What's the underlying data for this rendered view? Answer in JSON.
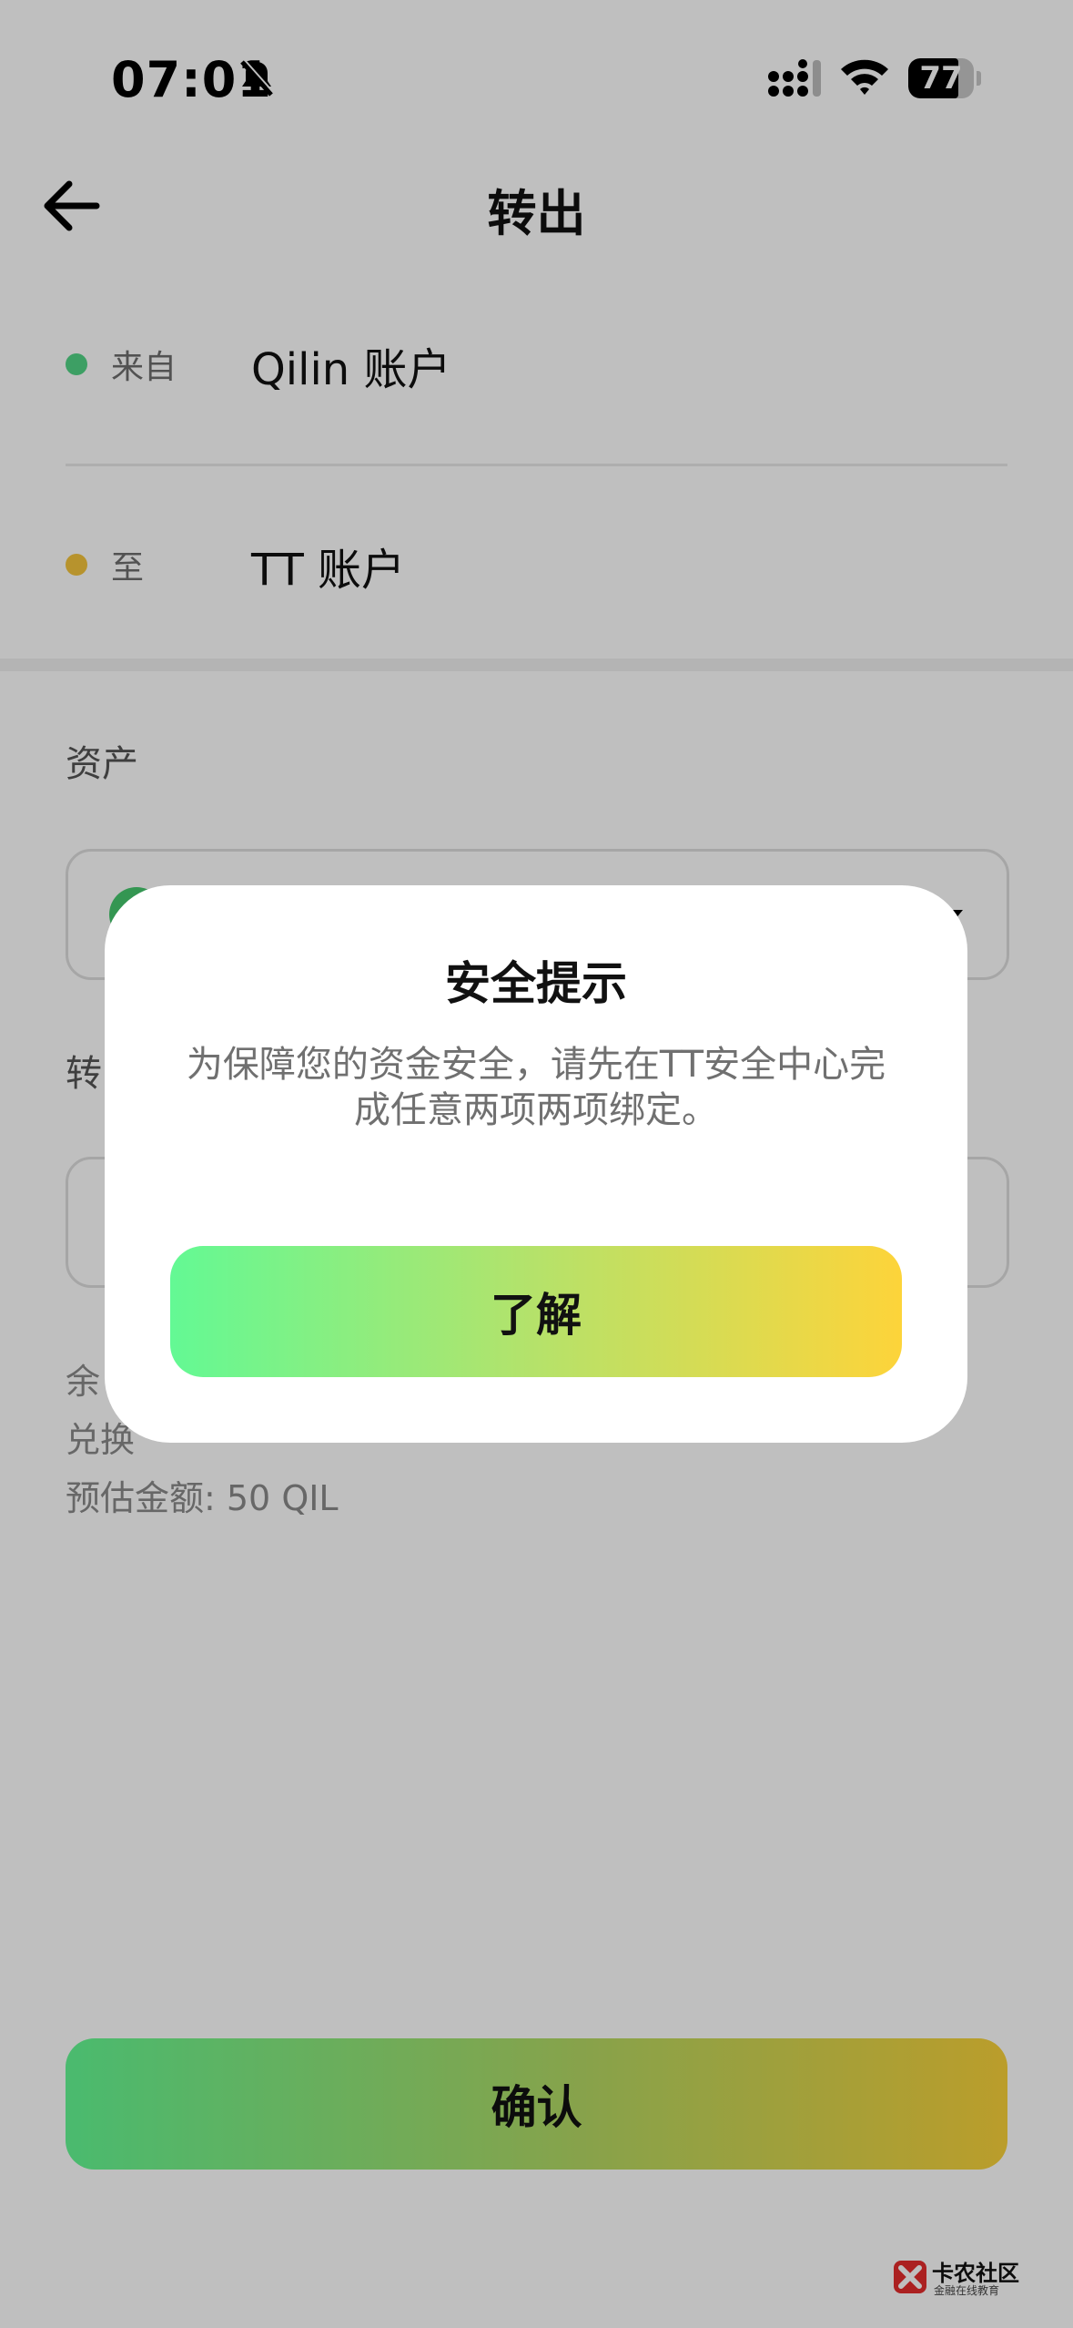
{
  "status_bar": {
    "time": "07:01",
    "battery_level": "77",
    "battery_fraction": 0.77
  },
  "header": {
    "title": "转出"
  },
  "route": {
    "from_label": "来自",
    "from_value": "Qilin 账户",
    "to_label": "至",
    "to_value": "TT 账户",
    "from_dot_color": "#52d486",
    "to_dot_color": "#f4c53c"
  },
  "asset": {
    "label": "资产"
  },
  "amount": {
    "label": "转"
  },
  "info": {
    "balance_label": "余",
    "exchange_label": "兑换",
    "estimate": "预估金额: 50 QIL"
  },
  "confirm_button_label": "确认",
  "modal": {
    "title": "安全提示",
    "message_line1": "为保障您的资金安全，请先在TT安全中心完",
    "message_line2": "成任意两项两项绑定。",
    "button_label": "了解"
  },
  "watermark": {
    "main": "卡农社区",
    "sub": "金融在线教育"
  },
  "icons": {
    "back": "back-arrow-icon",
    "bell": "bell-muted-icon",
    "signal": "cellular-signal-icon",
    "wifi": "wifi-icon",
    "chevron": "chevron-down-icon",
    "logo": "kanong-logo-icon"
  }
}
